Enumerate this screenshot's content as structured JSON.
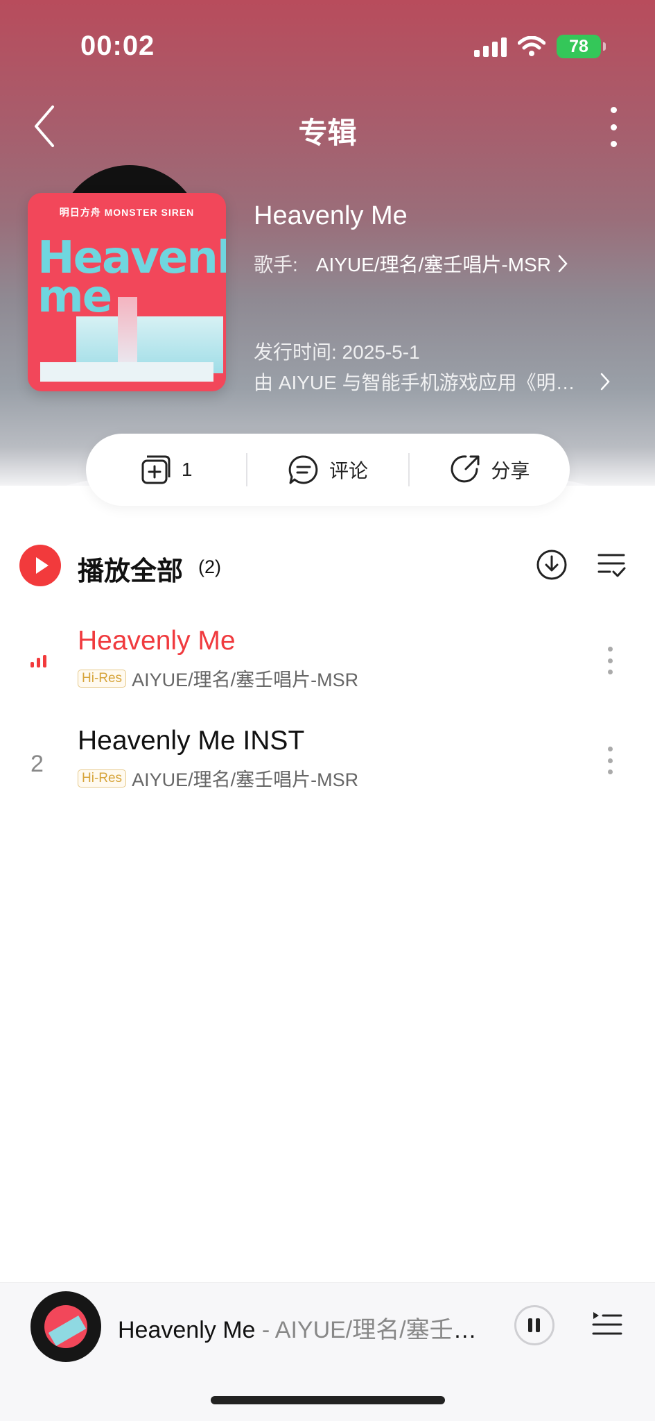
{
  "status_bar": {
    "time": "00:02",
    "battery": "78"
  },
  "nav": {
    "title": "专辑"
  },
  "album": {
    "title": "Heavenly Me",
    "artist_label": "歌手:",
    "artists": "AIYUE/理名/塞壬唱片-MSR",
    "release": "发行时间: 2025-5-1",
    "description": "由 AIYUE 与智能手机游戏应用《明日方舟》",
    "cover_text_top": "明日方舟  MONSTER SIREN",
    "cover_word": "Heavenly me"
  },
  "actions": {
    "collect_count": "1",
    "comment_label": "评论",
    "share_label": "分享"
  },
  "playlist": {
    "play_all_label": "播放全部",
    "count_label": "(2)",
    "tracks": [
      {
        "index": "",
        "title": "Heavenly Me",
        "badge": "Hi-Res",
        "artist": "AIYUE/理名/塞壬唱片-MSR",
        "playing": true
      },
      {
        "index": "2",
        "title": "Heavenly Me INST",
        "badge": "Hi-Res",
        "artist": "AIYUE/理名/塞壬唱片-MSR",
        "playing": false
      }
    ]
  },
  "mini_player": {
    "song": "Heavenly Me",
    "artist": " - AIYUE/理名/塞壬唱片-MSR"
  },
  "colors": {
    "accent": "#f23a3c",
    "playing_text": "#f03a3e",
    "hires": "#d6a43a"
  }
}
